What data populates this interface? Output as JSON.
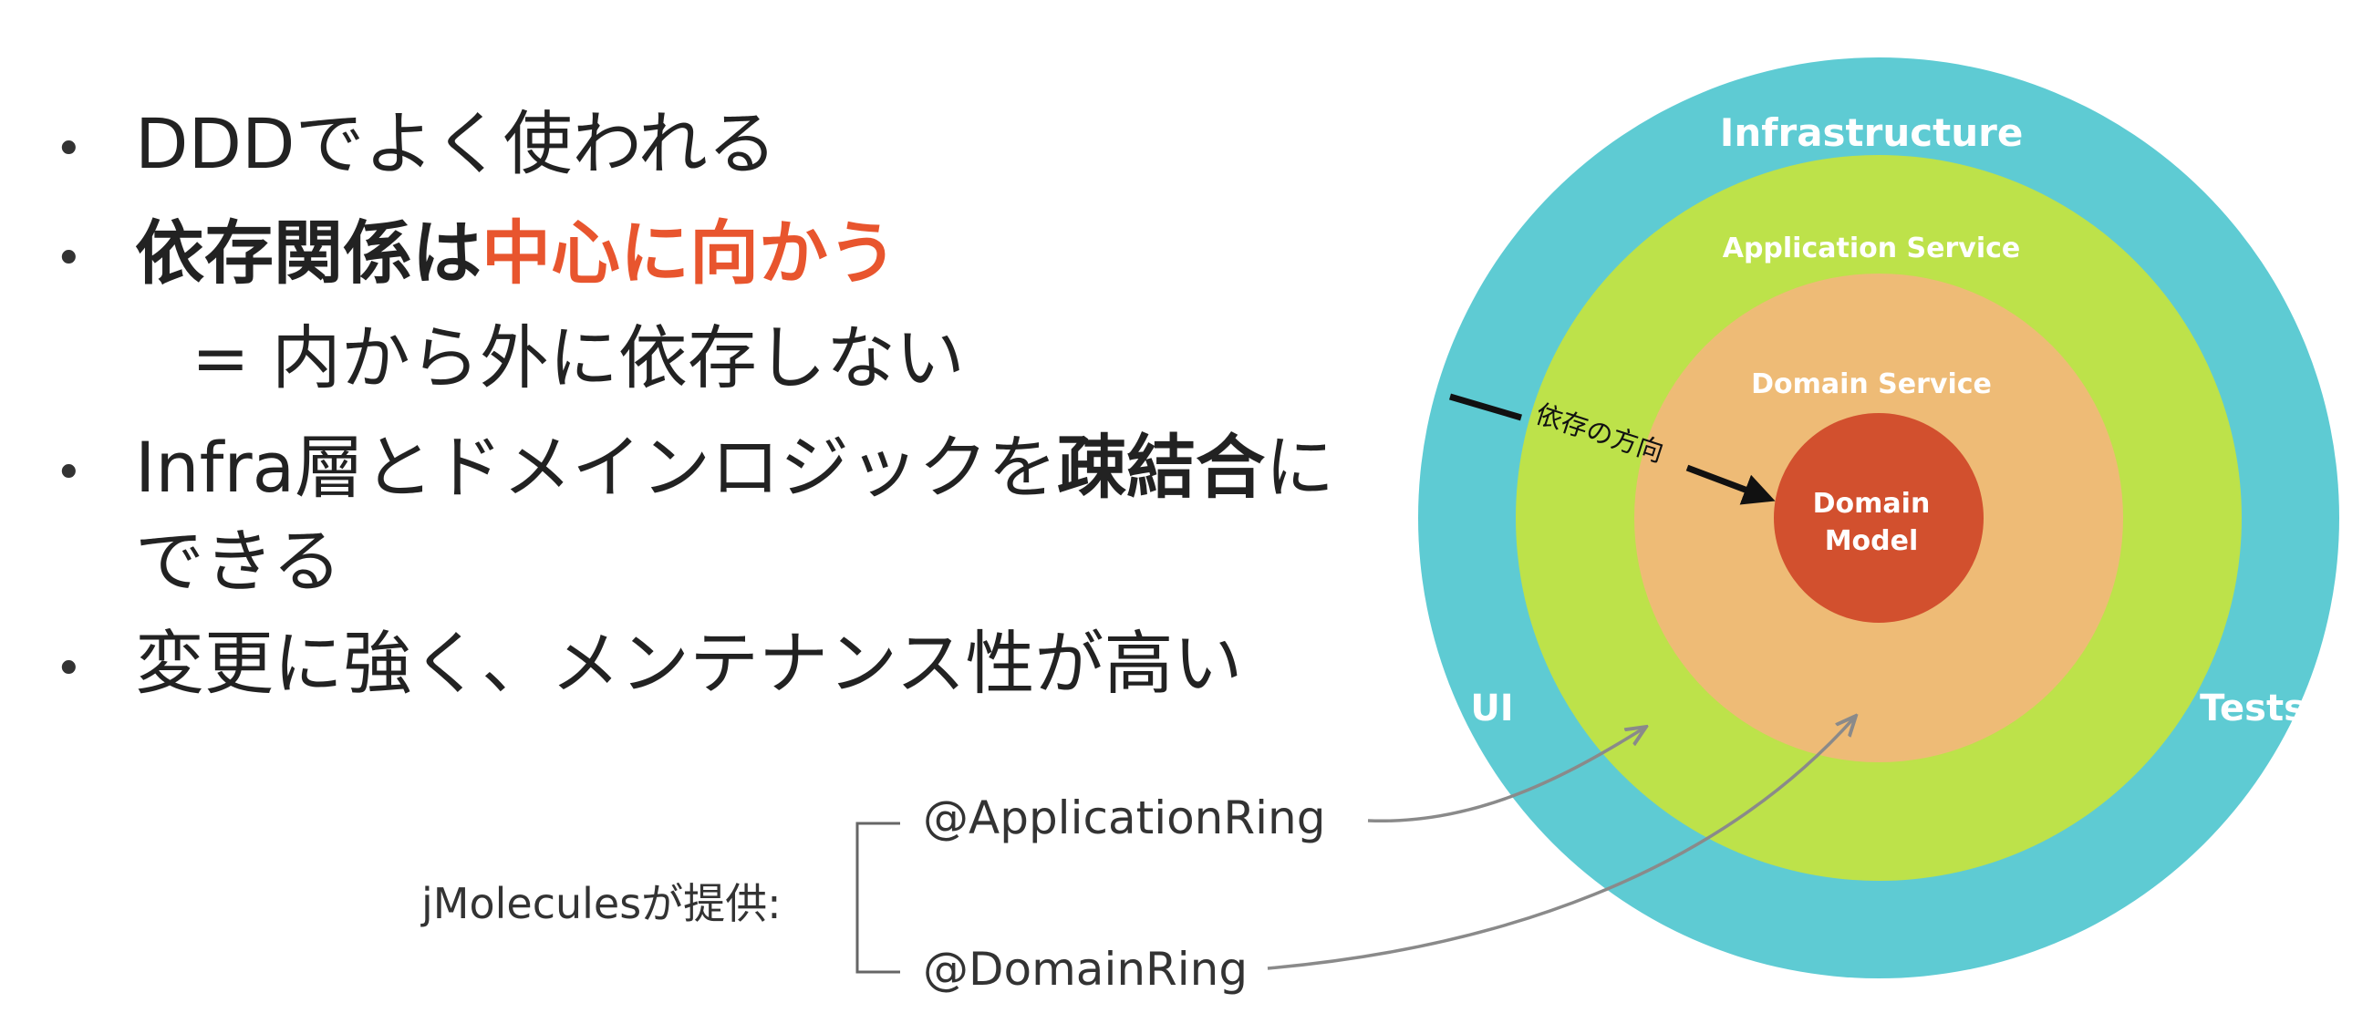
{
  "bullets": {
    "b1": "DDDでよく使われる",
    "b2_bold": "依存関係は",
    "b2_accent": "中心に向かう",
    "b3": "= 内から外に依存しない",
    "b4_pre": "Infra層とドメインロジックを",
    "b4_bold": "疎結合",
    "b4_post": "に",
    "b5": "できる",
    "b6": "変更に強く、メンテナンス性が高い"
  },
  "diagram": {
    "rings": {
      "infrastructure": "Infrastructure",
      "application_service": "Application Service",
      "domain_service": "Domain Service",
      "domain_model_line1": "Domain",
      "domain_model_line2": "Model"
    },
    "side_labels": {
      "ui": "UI",
      "tests": "Tests"
    },
    "dependency_direction": "依存の方向",
    "provider_label": "jMoleculesが提供:",
    "annotations": {
      "application_ring": "@ApplicationRing",
      "domain_ring": "@DomainRing"
    }
  },
  "colors": {
    "accent": "#E8552E",
    "infrastructure": "#5ECBD3",
    "application_service": "#BDE24A",
    "domain_service": "#EEBB76",
    "domain_model": "#D2502E",
    "arrow_gray": "#8A8A8A"
  }
}
